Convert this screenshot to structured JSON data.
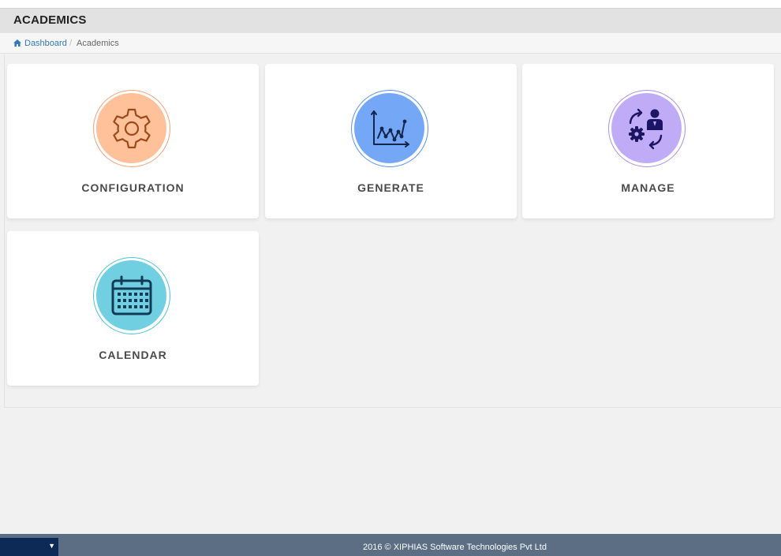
{
  "page": {
    "title": "ACADEMICS"
  },
  "breadcrumb": {
    "home_label": "Dashboard",
    "separator": "/",
    "current": "Academics"
  },
  "cards": [
    {
      "label": "CONFIGURATION",
      "icon": "gear-icon",
      "disc_color": "#ffc19a",
      "ring_color": "#f5a27a",
      "icon_color": "#9c4a1a"
    },
    {
      "label": "GENERATE",
      "icon": "line-chart-icon",
      "disc_color": "#74a8f6",
      "ring_color": "#5a93ee",
      "icon_color": "#14264d"
    },
    {
      "label": "MANAGE",
      "icon": "manage-user-settings-icon",
      "disc_color": "#c0acf6",
      "ring_color": "#a98ff0",
      "icon_color": "#1c1464"
    },
    {
      "label": "CALENDAR",
      "icon": "calendar-icon",
      "disc_color": "#70d0e2",
      "ring_color": "#4cc3da",
      "icon_color": "#123c55"
    }
  ],
  "footer": {
    "text": "2016 © XIPHIAS Software Technologies Pvt Ltd",
    "dropdown_caret": "▼"
  }
}
